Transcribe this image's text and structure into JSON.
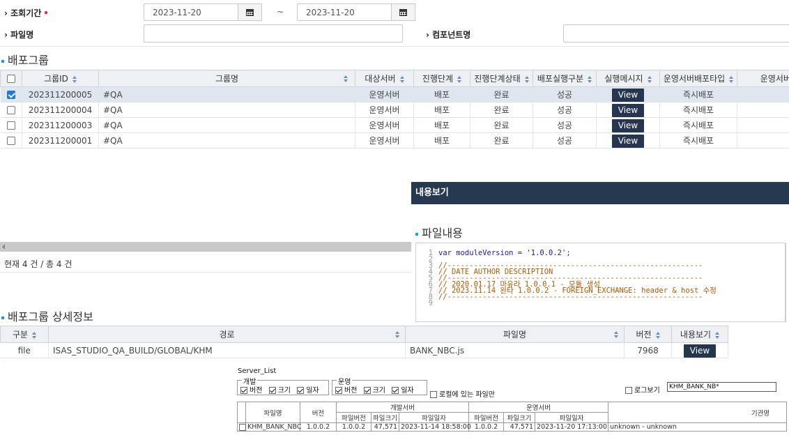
{
  "search": {
    "period_label": "조회기간",
    "required_mark": "•",
    "date_from": "2023-11-20",
    "date_to": "2023-11-20",
    "tilde": "~",
    "file_label": "파일명",
    "component_label": "컴포넌트명"
  },
  "group_section": {
    "title": "배포그룹",
    "columns": [
      "그룹ID",
      "그룹명",
      "대상서버",
      "진행단계",
      "진행단계상태",
      "배포실행구분",
      "실행메시지",
      "운영서버배포타입",
      "운영서버배"
    ],
    "rows": [
      {
        "id": "202311200005",
        "name": "#QA",
        "server": "운영서버",
        "stage": "배포",
        "status": "완료",
        "exec": "성공",
        "msg": "View",
        "type": "즉시배포",
        "checked": true
      },
      {
        "id": "202311200004",
        "name": "#QA",
        "server": "운영서버",
        "stage": "배포",
        "status": "완료",
        "exec": "성공",
        "msg": "View",
        "type": "즉시배포",
        "checked": false
      },
      {
        "id": "202311200003",
        "name": "#QA",
        "server": "운영서버",
        "stage": "배포",
        "status": "완료",
        "exec": "성공",
        "msg": "View",
        "type": "즉시배포",
        "checked": false
      },
      {
        "id": "202311200001",
        "name": "#QA",
        "server": "운영서버",
        "stage": "배포",
        "status": "완료",
        "exec": "성공",
        "msg": "View",
        "type": "즉시배포",
        "checked": false
      }
    ],
    "count_text": "현재 4 건 / 총 4 건"
  },
  "content_panel": {
    "header": "내용보기",
    "file_content_title": "파일내용",
    "lines": [
      "var moduleVersion = '1.0.0.2';",
      "",
      "//----------------------------------------------------------",
      "//    DATE       AUTHOR    DESCRIPTION",
      "//----------------------------------------------------------",
      "//  2020.01.17   마유라    1.0.0.1 - 모듈 생성",
      "//  2023.11.14   완타      1.0.0.2 - FOREIGN_EXCHANGE: header & host 수정",
      "//----------------------------------------------------------",
      ""
    ]
  },
  "detail_section": {
    "title": "배포그룹 상세정보",
    "columns": [
      "구분",
      "경로",
      "파일명",
      "버전",
      "내용보기"
    ],
    "row": {
      "kind": "file",
      "path": "ISAS_STUDIO_QA_BUILD/GLOBAL/KHM",
      "file": "BANK_NBC.js",
      "version": "7968",
      "view": "View"
    }
  },
  "server_list": {
    "title": "Server_List",
    "dev_group": "개발",
    "ops_group": "운영",
    "opt_version": "버전",
    "opt_size": "크기",
    "opt_date": "일자",
    "local_only": "로컬에 있는 파일만",
    "log_view": "로그보기",
    "filter_value": "KHM_BANK_NB*",
    "head_filename": "파일명",
    "head_version": "버전",
    "head_dev": "개발서버",
    "head_ops": "운영서버",
    "head_file_version": "파일버전",
    "head_file_size": "파일크기",
    "head_file_date": "파일일자",
    "head_org": "기관명",
    "row": {
      "name": "KHM_BANK_NBC",
      "version": "1.0.0.2",
      "dev_version": "1.0.0.2",
      "dev_size": "47,571",
      "dev_date": "2023-11-14 18:58:00",
      "ops_version": "1.0.0.2",
      "ops_size": "47,571",
      "ops_date": "2023-11-20 17:13:00",
      "org": "unknown - unknown"
    }
  }
}
